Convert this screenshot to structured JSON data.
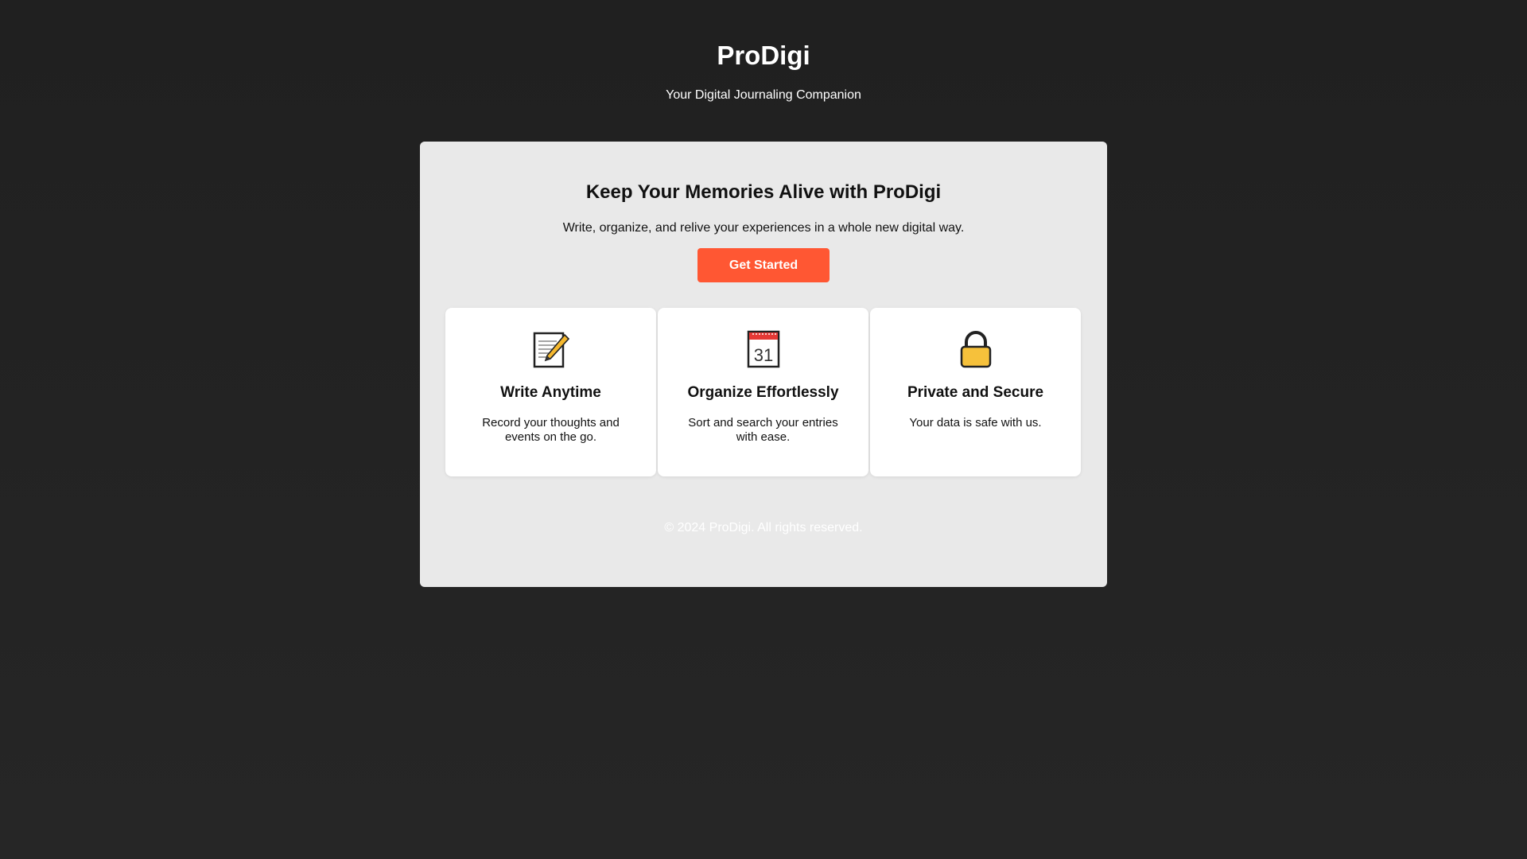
{
  "header": {
    "brand": "ProDigi",
    "tagline": "Your Digital Journaling Companion"
  },
  "hero": {
    "title": "Keep Your Memories Alive with ProDigi",
    "subtitle": "Write, organize, and relive your experiences in a whole new digital way.",
    "cta_label": "Get Started"
  },
  "features": [
    {
      "icon": "memo-icon",
      "title": "Write Anytime",
      "description": "Record your thoughts and events on the go."
    },
    {
      "icon": "calendar-icon",
      "title": "Organize Effortlessly",
      "description": "Sort and search your entries with ease.",
      "calendar_day": "31"
    },
    {
      "icon": "lock-icon",
      "title": "Private and Secure",
      "description": "Your data is safe with us."
    }
  ],
  "footer": {
    "text": "© 2024 ProDigi. All rights reserved."
  },
  "colors": {
    "background": "#232323",
    "panel": "#e9e9e9",
    "accent": "#ff5733",
    "card": "#ffffff"
  }
}
